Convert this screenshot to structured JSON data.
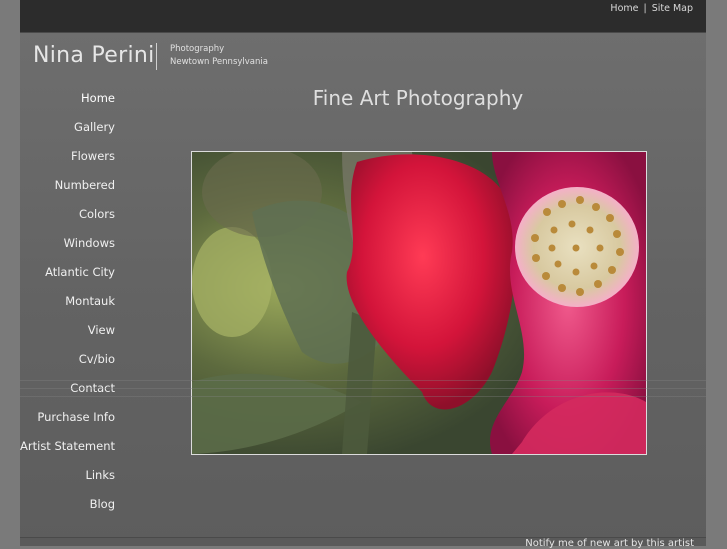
{
  "topbar": {
    "home": "Home",
    "separator": "|",
    "sitemap": "Site Map"
  },
  "brand": {
    "name": "Nina Perini",
    "tagline_line1": "Photography",
    "tagline_line2": "Newtown Pennsylvania"
  },
  "nav": [
    {
      "label": "Home"
    },
    {
      "label": "Gallery"
    },
    {
      "label": "Flowers"
    },
    {
      "label": "Numbered"
    },
    {
      "label": "Colors"
    },
    {
      "label": "Windows"
    },
    {
      "label": "Atlantic City"
    },
    {
      "label": "Montauk"
    },
    {
      "label": "View"
    },
    {
      "label": "Cv/bio"
    },
    {
      "label": "Contact"
    },
    {
      "label": "Purchase Info"
    },
    {
      "label": "Artist Statement"
    },
    {
      "label": "Links"
    },
    {
      "label": "Blog"
    }
  ],
  "main": {
    "title": "Fine Art Photography"
  },
  "footer": {
    "notify": "Notify me of new art by this artist"
  },
  "colors": {
    "page_bg": "#636363",
    "topbar_bg": "#2c2c2c",
    "text": "#f0f0f0"
  }
}
